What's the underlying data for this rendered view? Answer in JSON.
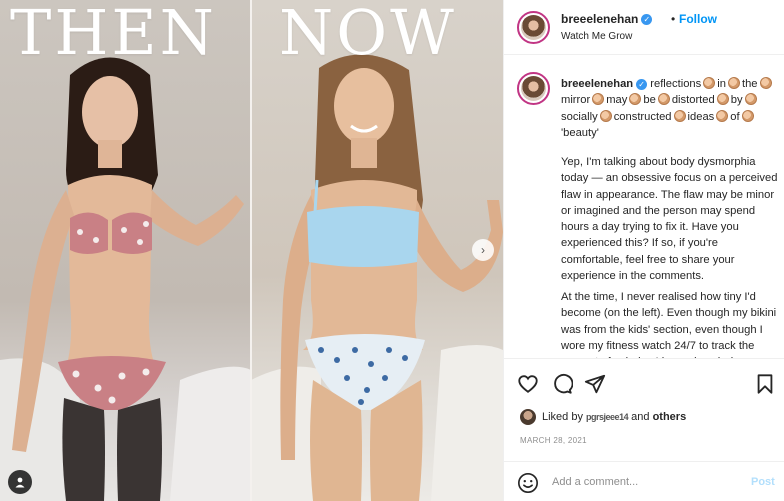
{
  "photo": {
    "then_label": "THEN",
    "now_label": "NOW",
    "next_icon": "chevron-right-icon",
    "tag_icon": "person-tag-icon"
  },
  "header": {
    "username": "breeelenehan",
    "verified_icon": "verified-badge-icon",
    "separator": "•",
    "follow_label": "Follow",
    "subtitle": "Watch Me Grow"
  },
  "caption": {
    "username": "breeelenehan",
    "words": [
      "reflections",
      "in",
      "the",
      "mirror",
      "may",
      "be",
      "distorted",
      "by",
      "socially",
      "constructed",
      "ideas",
      "of",
      "'beauty'"
    ],
    "clap_icon": "clapping-hands-icon",
    "paragraph1": "Yep, I'm talking about body dysmorphia today — an obsessive focus on a perceived flaw in appearance. The flaw may be minor or imagined and the person may spend hours a day trying to fix it. Have you experienced this? If so, if you're comfortable, feel free to share your experience in the comments.",
    "paragraph2": "At the time, I never realised how tiny I'd become (on the left). Even though my bikini was from the kids' section, even though I wore my fitness watch 24/7 to track the amount of calories I burned each day"
  },
  "actions": {
    "like_icon": "heart-icon",
    "comment_icon": "comment-icon",
    "share_icon": "share-icon",
    "save_icon": "bookmark-icon"
  },
  "likes": {
    "prefix": "Liked by",
    "liked_by_name": "pgrsjeee14",
    "connector": "and",
    "others": "others"
  },
  "date": "MARCH 28, 2021",
  "comment": {
    "emoji_icon": "smiley-icon",
    "placeholder": "Add a comment...",
    "post_label": "Post"
  }
}
